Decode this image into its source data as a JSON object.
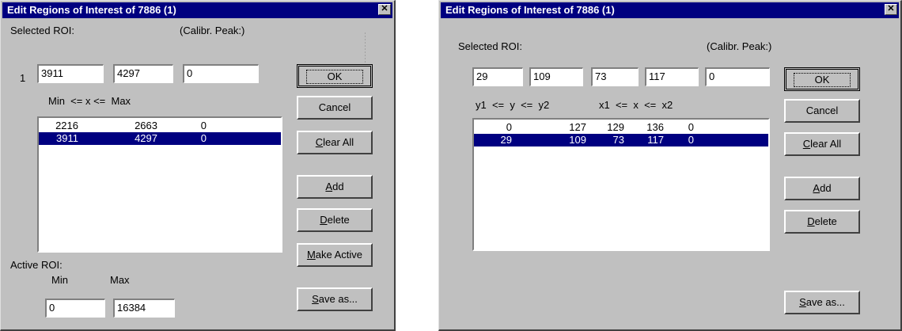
{
  "dialog1": {
    "title": "Edit Regions of Interest of 7886 (1)",
    "selected_roi_label": "Selected ROI:",
    "calibr_label": "(Calibr. Peak:)",
    "row_index": "1",
    "min_value": "3911",
    "max_value": "4297",
    "calibr_value": "0",
    "range_caption": "Min  <= x <=  Max",
    "rows": [
      {
        "c1": "2216",
        "c2": "2663",
        "c3": "0"
      },
      {
        "c1": "3911",
        "c2": "4297",
        "c3": "0"
      }
    ],
    "active_roi_label": "Active ROI:",
    "active_min_label": "Min",
    "active_max_label": "Max",
    "active_min_value": "0",
    "active_max_value": "16384",
    "buttons": {
      "ok": "OK",
      "cancel": "Cancel",
      "clear_all": "Clear All",
      "add": "Add",
      "delete": "Delete",
      "make_active": "Make Active",
      "save_as": "Save as..."
    }
  },
  "dialog2": {
    "title": "Edit Regions of Interest of 7886 (1)",
    "selected_roi_label": "Selected ROI:",
    "calibr_label": "(Calibr. Peak:)",
    "y1_value": "29",
    "y2_value": "109",
    "x1_value": "73",
    "x2_value": "117",
    "calibr_value": "0",
    "y_caption": "y1  <=  y  <=  y2",
    "x_caption": "x1  <=  x  <=  x2",
    "rows": [
      {
        "c1": "0",
        "c2": "127",
        "c3": "129",
        "c4": "136",
        "c5": "0"
      },
      {
        "c1": "29",
        "c2": "109",
        "c3": "73",
        "c4": "117",
        "c5": "0"
      }
    ],
    "buttons": {
      "ok": "OK",
      "cancel": "Cancel",
      "clear_all": "Clear All",
      "add": "Add",
      "delete": "Delete",
      "save_as": "Save as..."
    }
  },
  "selected_row_index": 1,
  "colors": {
    "titlebar": "#000080",
    "dialog_face": "#c0c0c0",
    "selection": "#000080"
  }
}
